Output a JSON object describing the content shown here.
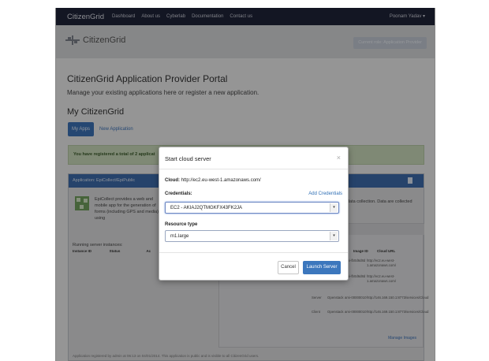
{
  "navbar": {
    "brand": "CitizenGrid",
    "items": [
      "Dashboard",
      "About us",
      "Cyberlab",
      "Documentation",
      "Contact us"
    ],
    "user": "Poonam Yadav ▾"
  },
  "header": {
    "logo_text": "CitizenGrid",
    "current_role": "Current role: Application Provider"
  },
  "page": {
    "title": "CitizenGrid Application Provider Portal",
    "subtitle": "Manage your existing applications here or register a new application.",
    "section_title": "My CitizenGrid",
    "tabs": [
      "My Apps",
      "New Application"
    ],
    "alert": "You have registered a total of 2 applicat"
  },
  "panel": {
    "heading": "Application: EpiCollect/EpiPublic",
    "description": "EpiCollect provides a web and mobile app for the generation of forms (including GPS and media) using",
    "description_right": "data collection. Data are collected",
    "running_title": "Running server instances:",
    "running_cols": [
      "Instance ID",
      "Status",
      "Ac"
    ],
    "resource_cols": [
      "Image ID",
      "Cloud URL"
    ],
    "rows": [
      {
        "type": "",
        "cloud": "",
        "image": "ami-fb0d6d8d",
        "url": "http://ec2.eu-west-1.amazonaws.com/"
      },
      {
        "type": "",
        "cloud": "",
        "image": "ami-fb0d6d8d",
        "url": "http://ec2.eu-west-1.amazonaws.com/"
      },
      {
        "type": "Server",
        "cloud": "Openstack",
        "image": "ami-00000010",
        "url": "http://146.169.150.1:8773/services/Cloud"
      },
      {
        "type": "Client",
        "cloud": "Openstack",
        "image": "ami-00000010",
        "url": "http://146.169.150.1:8773/services/Cloud"
      }
    ],
    "manage_images": "Manage Images",
    "footer_note": "Application registered by admin at 06:13 on 04/01/2014. This application is public and is visible to all CitizenGrid users."
  },
  "modal": {
    "title": "Start cloud server",
    "close": "×",
    "cloud_label": "Cloud:",
    "cloud_value": "http://ec2.eu-west-1.amazonaws.com/",
    "credentials_label": "Credentials:",
    "add_credentials": "Add Credentials",
    "credentials_value": "EC2 - AKIAJ2QTMGKFX43FK2JA",
    "resource_label": "Resource type",
    "resource_value": "m1.large",
    "cancel": "Cancel",
    "launch": "Launch Server"
  },
  "colors": {
    "navbar": "#1f2338",
    "primary": "#3c77bd",
    "panel_head": "#3c69a8",
    "alert_bg": "#c7d6b8"
  },
  "icons": [
    "logo-icon",
    "trash-icon",
    "app-icon",
    "dropdown-arrow-icon",
    "close-icon"
  ]
}
